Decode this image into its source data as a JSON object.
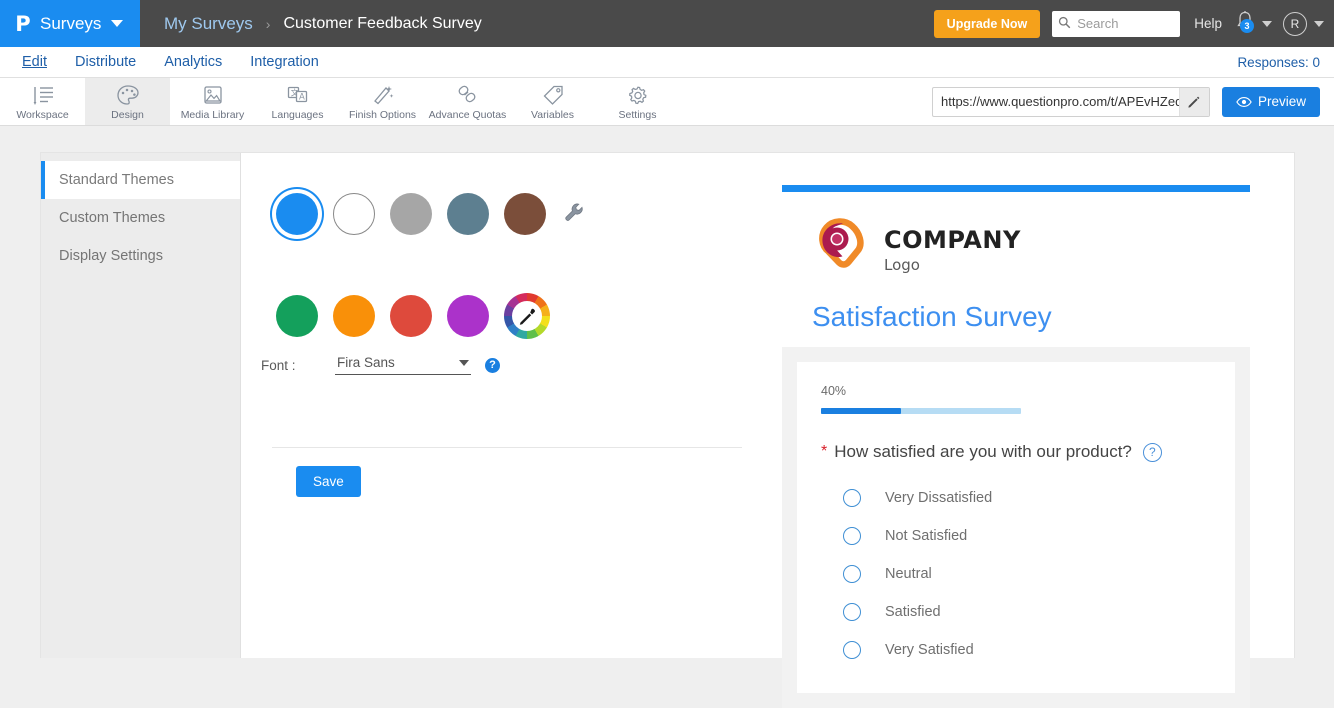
{
  "header": {
    "brand_logo": "P",
    "brand_label": "Surveys",
    "breadcrumb_parent": "My Surveys",
    "breadcrumb_sep": "›",
    "breadcrumb_current": "Customer Feedback Survey",
    "upgrade_label": "Upgrade Now",
    "search_placeholder": "Search",
    "search_value": "",
    "help_label": "Help",
    "notification_count": "3",
    "avatar_initial": "R",
    "accent_color": "#1a8cf0",
    "upgrade_color": "#f5a11b",
    "bar_color": "#4a4a4a"
  },
  "nav": {
    "tabs": [
      {
        "label": "Edit",
        "active": true
      },
      {
        "label": "Distribute",
        "active": false
      },
      {
        "label": "Analytics",
        "active": false
      },
      {
        "label": "Integration",
        "active": false
      }
    ],
    "responses": "Responses: 0"
  },
  "toolbar": {
    "items": [
      {
        "label": "Workspace",
        "icon": "workspace-icon",
        "active": false
      },
      {
        "label": "Design",
        "icon": "palette-icon",
        "active": true
      },
      {
        "label": "Media Library",
        "icon": "image-icon",
        "active": false
      },
      {
        "label": "Languages",
        "icon": "translate-icon",
        "active": false
      },
      {
        "label": "Finish Options",
        "icon": "magic-wand-icon",
        "active": false
      },
      {
        "label": "Advance Quotas",
        "icon": "chain-link-icon",
        "active": false
      },
      {
        "label": "Variables",
        "icon": "tag-icon",
        "active": false
      },
      {
        "label": "Settings",
        "icon": "gear-icon",
        "active": false
      }
    ],
    "survey_url": "https://www.questionpro.com/t/APEvHZeq",
    "preview_label": "Preview"
  },
  "sidebar": {
    "items": [
      {
        "label": "Standard Themes",
        "active": true
      },
      {
        "label": "Custom Themes",
        "active": false
      },
      {
        "label": "Display Settings",
        "active": false
      }
    ]
  },
  "design": {
    "theme_colors_row1": [
      {
        "name": "blue",
        "hex": "#1a8cf0",
        "selected": true
      },
      {
        "name": "white",
        "hex": "#ffffff",
        "selected": false
      },
      {
        "name": "gray",
        "hex": "#a6a6a6",
        "selected": false
      },
      {
        "name": "slate-blue",
        "hex": "#5d7f90",
        "selected": false
      },
      {
        "name": "brown",
        "hex": "#7b4e3a",
        "selected": false
      }
    ],
    "theme_colors_row2": [
      {
        "name": "green",
        "hex": "#14a05c",
        "selected": false
      },
      {
        "name": "orange",
        "hex": "#f99009",
        "selected": false
      },
      {
        "name": "red",
        "hex": "#de4a3c",
        "selected": false
      },
      {
        "name": "purple",
        "hex": "#ab32ca",
        "selected": false
      }
    ],
    "font_label": "Font :",
    "font_value": "Fira Sans",
    "help_glyph": "?",
    "save_label": "Save"
  },
  "preview": {
    "logo_company": "COMPANY",
    "logo_sub": "Logo",
    "survey_title": "Satisfaction Survey",
    "progress_percent_label": "40%",
    "progress_percent": 40,
    "question_text": "How satisfied are you with our product?",
    "required_marker": "*",
    "question_help_glyph": "?",
    "options": [
      "Very Dissatisfied",
      "Not Satisfied",
      "Neutral",
      "Satisfied",
      "Very Satisfied"
    ],
    "title_color": "#3d8ff0",
    "topbar_color": "#1a8cf0"
  }
}
